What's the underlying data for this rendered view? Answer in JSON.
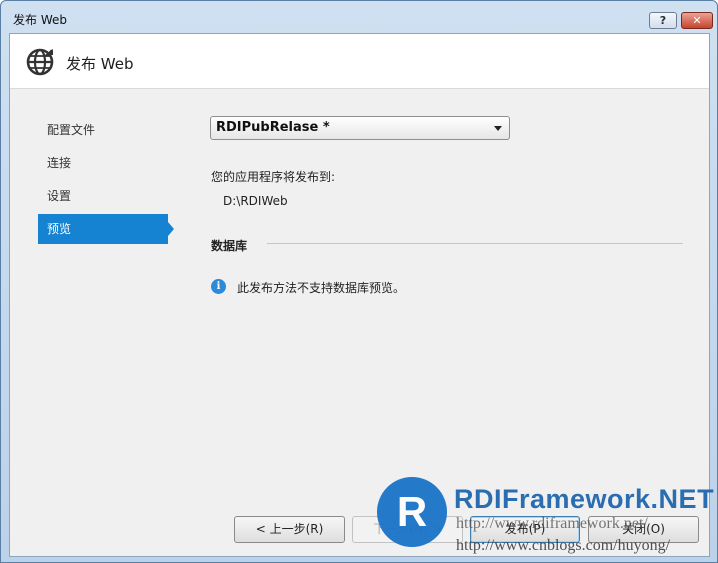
{
  "window": {
    "title": "发布 Web",
    "help_label": "?",
    "close_label": "✕"
  },
  "header": {
    "title": "发布 Web",
    "icon": "globe-publish-icon"
  },
  "nav": {
    "items": [
      {
        "label": "配置文件"
      },
      {
        "label": "连接"
      },
      {
        "label": "设置"
      },
      {
        "label": "预览",
        "active": true
      }
    ]
  },
  "main": {
    "profile_value": "RDIPubRelase *",
    "dest_label": "您的应用程序将发布到:",
    "dest_path": "D:\\RDIWeb",
    "db_header": "数据库",
    "info_icon": "info-icon",
    "info_text": "此发布方法不支持数据库预览。"
  },
  "buttons": {
    "prev": "< 上一步(R)",
    "next": "下一步(N) >",
    "publish": "发布(P)",
    "close": "关闭(O)"
  },
  "watermark": {
    "logo_letter": "R",
    "brand": "RDIFramework.NET",
    "url1": "http://www.rdiframework.net/",
    "url2": "http://www.cnblogs.com/huyong/"
  },
  "colors": {
    "accent": "#1583d1",
    "title_bar": "#cfe0f1",
    "close_button": "#c8432c"
  }
}
